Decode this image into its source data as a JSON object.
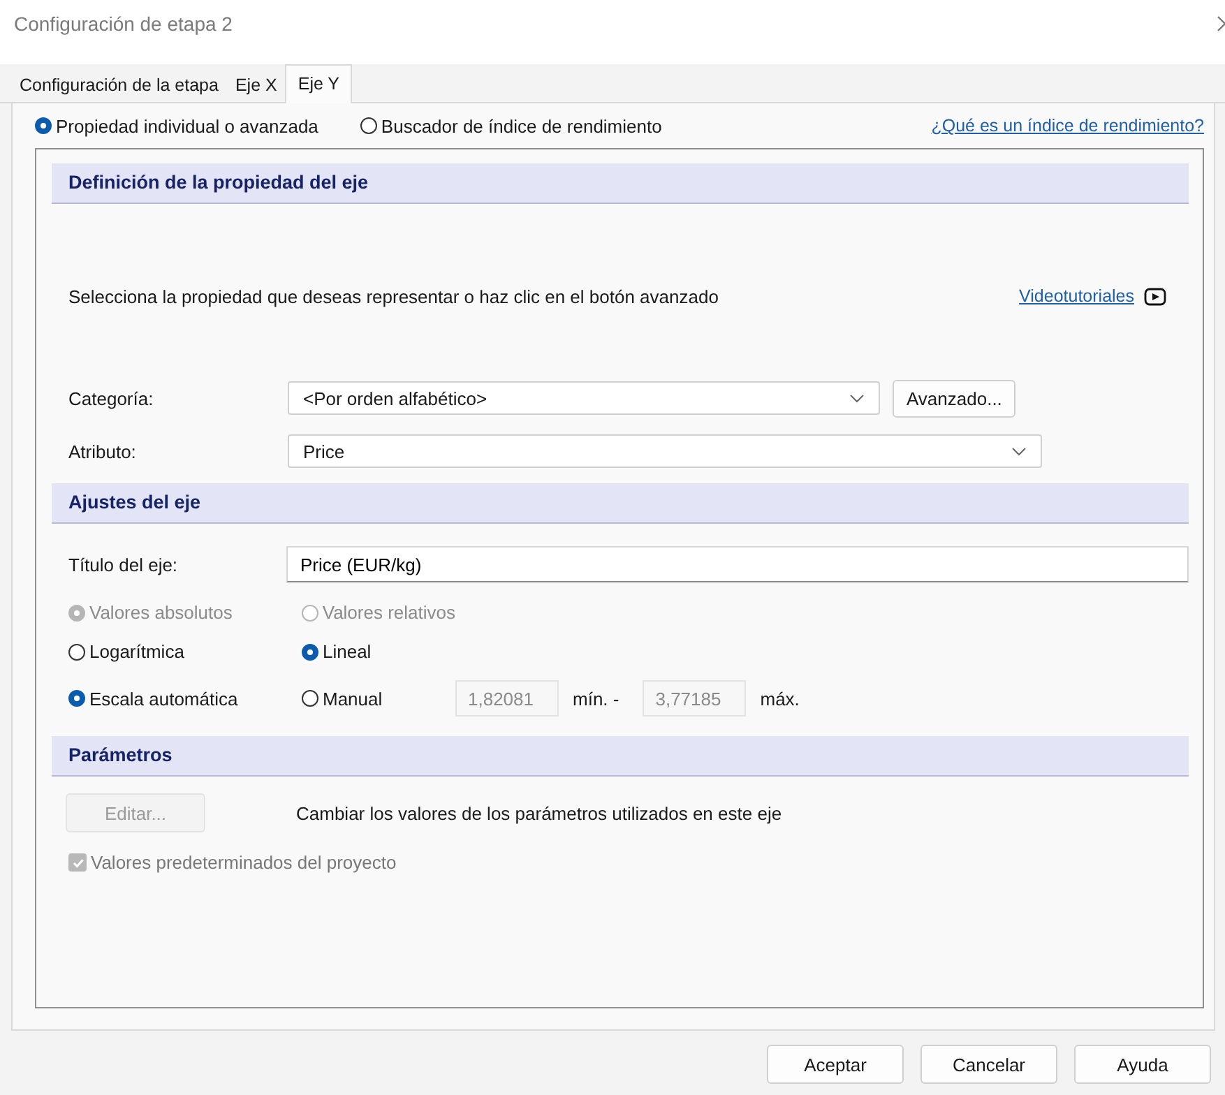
{
  "window": {
    "title": "Configuración de etapa 2"
  },
  "tabs": [
    {
      "label": "Configuración de la etapa",
      "selected": false
    },
    {
      "label": "Eje X",
      "selected": false
    },
    {
      "label": "Eje Y",
      "selected": true
    }
  ],
  "mode_options": [
    {
      "label": "Propiedad individual o avanzada",
      "selected": true
    },
    {
      "label": "Buscador de índice de rendimiento",
      "selected": false
    }
  ],
  "help_link": "¿Qué es un índice de rendimiento?",
  "definition": {
    "header": "Definición de la propiedad del eje",
    "instruction": "Selecciona la propiedad que deseas representar o haz clic en el botón avanzado",
    "tutorials_link": "Videotutoriales",
    "category": {
      "label": "Categoría:",
      "value": "<Por orden alfabético>"
    },
    "advanced_button": "Avanzado...",
    "attribute": {
      "label": "Atributo:",
      "value": "Price"
    }
  },
  "axis_settings": {
    "header": "Ajustes del eje",
    "title_field": {
      "label": "Título del eje:",
      "value": "Price (EUR/kg)"
    },
    "value_type": [
      {
        "label": "Valores absolutos",
        "selected": true,
        "disabled": true
      },
      {
        "label": "Valores relativos",
        "selected": false,
        "disabled": true
      }
    ],
    "scale_type": [
      {
        "label": "Logarítmica",
        "selected": false,
        "disabled": false
      },
      {
        "label": "Lineal",
        "selected": true,
        "disabled": false
      }
    ],
    "range_mode": [
      {
        "label": "Escala automática",
        "selected": true,
        "disabled": false
      },
      {
        "label": "Manual",
        "selected": false,
        "disabled": false
      }
    ],
    "min": {
      "value": "1,82081",
      "disabled": true
    },
    "min_label": "mín. -",
    "max": {
      "value": "3,77185",
      "disabled": true
    },
    "max_label": "máx."
  },
  "parameters": {
    "header": "Parámetros",
    "edit_button": {
      "label": "Editar...",
      "disabled": true
    },
    "description": "Cambiar los valores de los parámetros utilizados en este eje",
    "defaults_checkbox": {
      "label": "Valores predeterminados del proyecto",
      "checked": true,
      "disabled": true
    }
  },
  "buttons": [
    "Aceptar",
    "Cancelar",
    "Ayuda"
  ]
}
